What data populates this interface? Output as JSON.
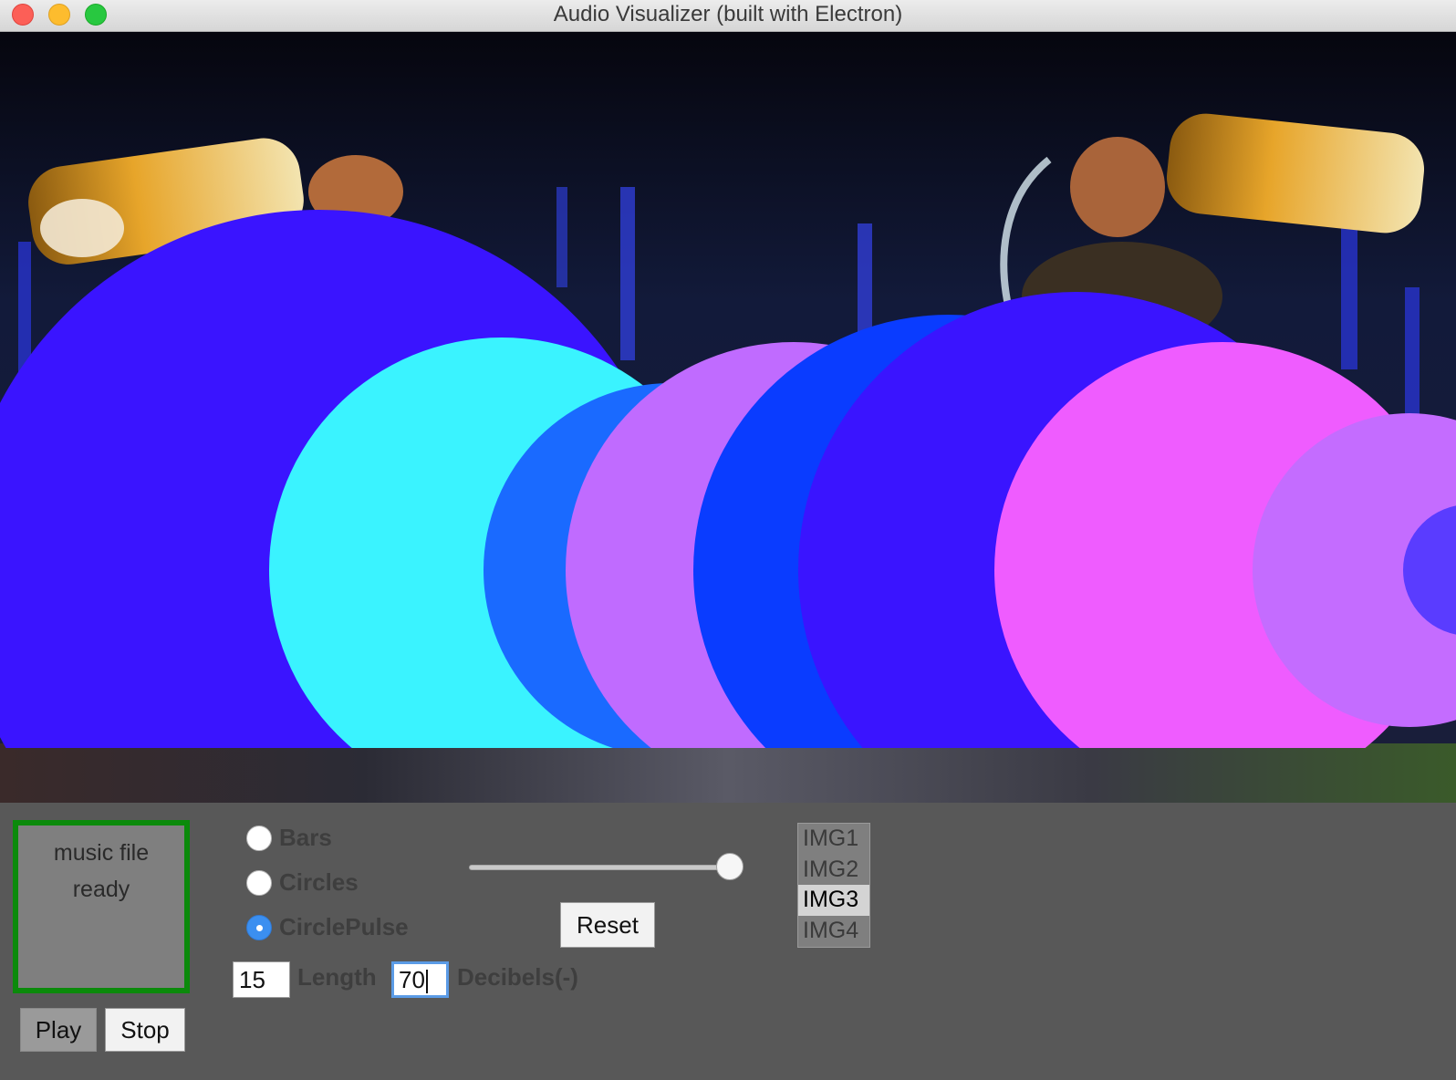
{
  "window": {
    "title": "Audio Visualizer (built with Electron)"
  },
  "visualizer": {
    "mode": "CirclePulse",
    "circle_colors": [
      "#3a14ff",
      "#3af3ff",
      "#1a6aff",
      "#c06bff",
      "#0a3cff",
      "#3a14ff",
      "#ef5cff",
      "#c46cff",
      "#5a3cff"
    ]
  },
  "dropzone": {
    "line1": "music file",
    "line2": "ready"
  },
  "playback": {
    "play_label": "Play",
    "stop_label": "Stop"
  },
  "modes": [
    {
      "label": "Bars",
      "checked": false
    },
    {
      "label": "Circles",
      "checked": false
    },
    {
      "label": "CirclePulse",
      "checked": true
    }
  ],
  "slider": {
    "level": 1.0
  },
  "reset_label": "Reset",
  "fields": {
    "length_value": "15",
    "length_label": "Length",
    "decibels_value": "70",
    "decibels_label": "Decibels(-)"
  },
  "images": {
    "items": [
      "IMG1",
      "IMG2",
      "IMG3",
      "IMG4"
    ],
    "selected": "IMG3"
  },
  "colors": {
    "dropzone_border": "#0b8a0b",
    "radio_checked": "#3b8ff0",
    "focus_ring": "#5b9be6"
  }
}
